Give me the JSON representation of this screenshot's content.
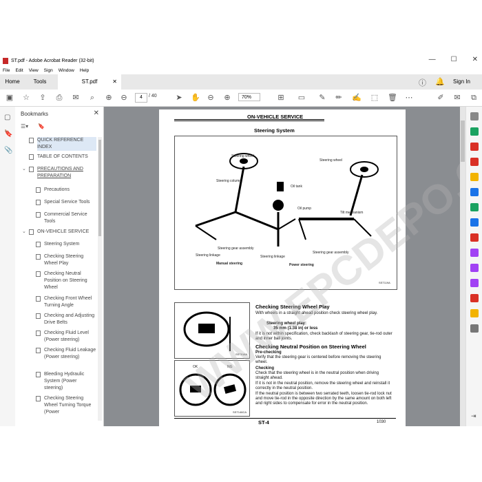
{
  "window": {
    "title": "ST.pdf - Adobe Acrobat Reader (32-bit)",
    "minimize": "—",
    "maximize": "☐",
    "close": "✕"
  },
  "menu": [
    "File",
    "Edit",
    "View",
    "Sign",
    "Window",
    "Help"
  ],
  "tabs": {
    "home": "Home",
    "tools": "Tools",
    "doc": "ST.pdf",
    "signin": "Sign In"
  },
  "toolbar": {
    "page_current": "4",
    "page_total": "/ 40",
    "zoom": "70%"
  },
  "bookmarks": {
    "title": "Bookmarks",
    "items": [
      {
        "label": "QUICK REFERENCE INDEX",
        "level": 0,
        "selected": true
      },
      {
        "label": "TABLE OF CONTENTS",
        "level": 0
      },
      {
        "label": "PRECAUTIONS AND PREPARATION",
        "level": 0,
        "expanded": true
      },
      {
        "label": "Precautions",
        "level": 1
      },
      {
        "label": "Special Service Tools",
        "level": 1
      },
      {
        "label": "Commercial Service Tools",
        "level": 1
      },
      {
        "label": "ON-VEHICLE SERVICE",
        "level": 0,
        "expanded": true
      },
      {
        "label": "Steering System",
        "level": 1
      },
      {
        "label": "Checking Steering Wheel Play",
        "level": 1
      },
      {
        "label": "Checking Neutral Position on Steering Wheel",
        "level": 1
      },
      {
        "label": "Checking Front Wheel Turning Angle",
        "level": 1
      },
      {
        "label": "Checking and Adjusting Drive Belts",
        "level": 1
      },
      {
        "label": "Checking Fluid Level (Power steering)",
        "level": 1
      },
      {
        "label": "Checking Fluid Leakage (Power steering)",
        "level": 1
      },
      {
        "label": "Bleeding Hydraulic System (Power steering)",
        "level": 1
      },
      {
        "label": "Checking Steering Wheel Turning Torque (Power",
        "level": 1
      }
    ]
  },
  "document": {
    "section": "ON-VEHICLE SERVICE",
    "heading": "Steering System",
    "fig1_labels": {
      "sw1": "Steering wheel",
      "sw2": "Steering wheel",
      "col": "Steering column",
      "oil_tank": "Oil tank",
      "oil_pump": "Oil pump",
      "tilt": "Tilt mechanism",
      "gear1": "Steering gear assembly",
      "link1": "Steering linkage",
      "link2": "Steering linkage",
      "gear2": "Steering gear assembly",
      "manual": "Manual steering",
      "power": "Power steering",
      "code": "SST119A"
    },
    "h_play": "Checking Steering Wheel Play",
    "play_1": "With wheels in a straight ahead position check steering wheel play.",
    "play_spec_label": "Steering wheel play:",
    "play_spec": "35 mm (1.38 in) or less",
    "play_2": "If it is not within specification, check backlash of steering gear, tie-rod outer and inner ball joints.",
    "h_neutral": "Checking Neutral Position on Steering Wheel",
    "h_prechk": "Pre-checking",
    "pre_1": "Verify that the steering gear is centered before removing the steering wheel.",
    "h_chk": "Checking",
    "chk_1": "Check that the steering wheel is in the neutral position when driving straight ahead.",
    "chk_2": "If it is not in the neutral position, remove the steering wheel and reinstall it correctly in the neutral position.",
    "chk_3": "If the neutral position is between two serrated teeth, loosen tie-rod lock nut and move tie-rod in the opposite direction by the same amount on both left and right sides to compensate for error in the neutral position.",
    "fig2_code": "SST918A",
    "fig3_ok": "OK",
    "fig3_ng": "NG",
    "fig3_code": "SST146CA",
    "page_label": "ST-4",
    "page_number": "1030",
    "watermark": "WWW.EPCDEPO.COM"
  }
}
